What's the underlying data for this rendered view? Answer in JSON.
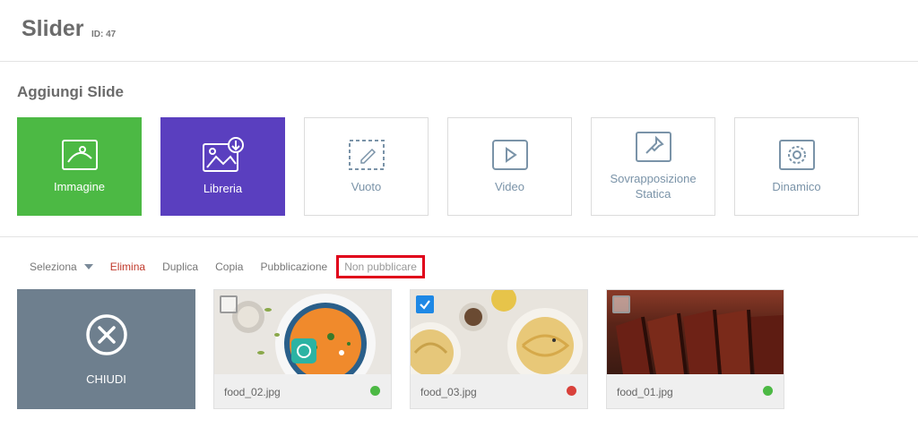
{
  "header": {
    "title": "Slider",
    "id_label": "ID: 47"
  },
  "add_section": {
    "title": "Aggiungi Slide",
    "tiles": [
      {
        "label": "Immagine",
        "icon": "image-icon",
        "color": "#4cb944"
      },
      {
        "label": "Libreria",
        "icon": "library-download-icon",
        "color": "#5a3fbf"
      },
      {
        "label": "Vuoto",
        "icon": "empty-dashed-icon"
      },
      {
        "label": "Video",
        "icon": "video-play-icon"
      },
      {
        "label": "Sovrapposizione Statica",
        "icon": "pin-icon"
      },
      {
        "label": "Dinamico",
        "icon": "gear-icon"
      }
    ]
  },
  "toolbar": {
    "select": "Seleziona",
    "delete": "Elimina",
    "duplicate": "Duplica",
    "copy": "Copia",
    "publish": "Pubblicazione",
    "unpublish": "Non pubblicare"
  },
  "slides": {
    "close_label": "CHIUDI",
    "items": [
      {
        "filename": "food_02.jpg",
        "checked": false,
        "status": "published"
      },
      {
        "filename": "food_03.jpg",
        "checked": true,
        "status": "unpublished"
      },
      {
        "filename": "food_01.jpg",
        "checked": false,
        "status": "published"
      }
    ]
  },
  "colors": {
    "accent_highlight": "#e0001a",
    "ok": "#4cb944",
    "error": "#d9413b",
    "checkbox": "#1e88e5"
  }
}
